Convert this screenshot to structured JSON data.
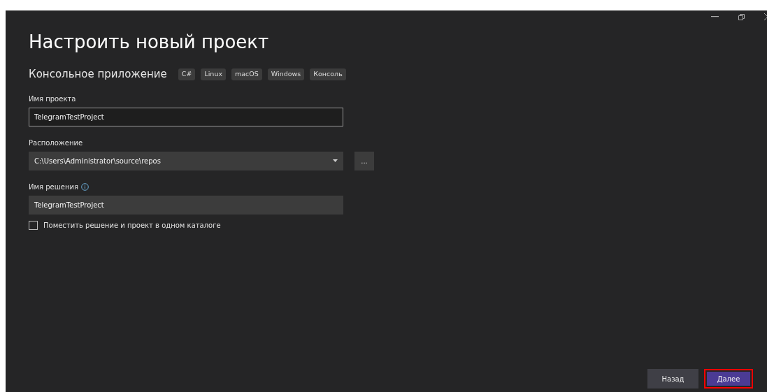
{
  "title": "Настроить новый проект",
  "template": {
    "name": "Консольное приложение",
    "tags": [
      "C#",
      "Linux",
      "macOS",
      "Windows",
      "Консоль"
    ]
  },
  "project_name": {
    "label": "Имя проекта",
    "value": "TelegramTestProject",
    "focused": true
  },
  "location": {
    "label": "Расположение",
    "value": "C:\\Users\\Administrator\\source\\repos",
    "browse_label": "..."
  },
  "solution_name": {
    "label": "Имя решения",
    "value": "TelegramTestProject"
  },
  "same_folder": {
    "label": "Поместить решение и проект в одном каталоге",
    "checked": false
  },
  "buttons": [
    {
      "label": "Назад",
      "kind": "secondary",
      "highlighted": false
    },
    {
      "label": "Далее",
      "kind": "primary",
      "highlighted": true
    }
  ]
}
